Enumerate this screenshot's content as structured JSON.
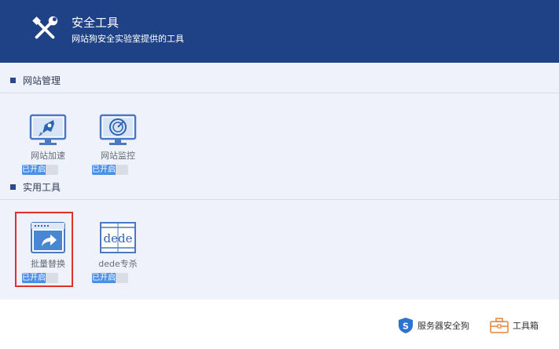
{
  "header": {
    "title": "安全工具",
    "subtitle": "网站狗安全实验室提供的工具"
  },
  "sections": [
    {
      "label": "网站管理",
      "tools": [
        {
          "name": "网站加速",
          "status": "已开启",
          "icon": "rocket-monitor-icon"
        },
        {
          "name": "网站监控",
          "status": "已开启",
          "icon": "monitor-radar-icon"
        }
      ]
    },
    {
      "label": "实用工具",
      "tools": [
        {
          "name": "批量替换",
          "status": "已开启",
          "icon": "batch-replace-icon"
        },
        {
          "name": "dede专杀",
          "status": "已开启",
          "icon": "dede-icon"
        }
      ]
    }
  ],
  "footer": {
    "server_guard": "服务器安全狗",
    "toolbox": "工具箱"
  },
  "colors": {
    "header_bg": "#1f4287",
    "panel_bg": "#eff2fb",
    "toggle_on": "#4b8fe8",
    "highlight": "#e0302c"
  }
}
